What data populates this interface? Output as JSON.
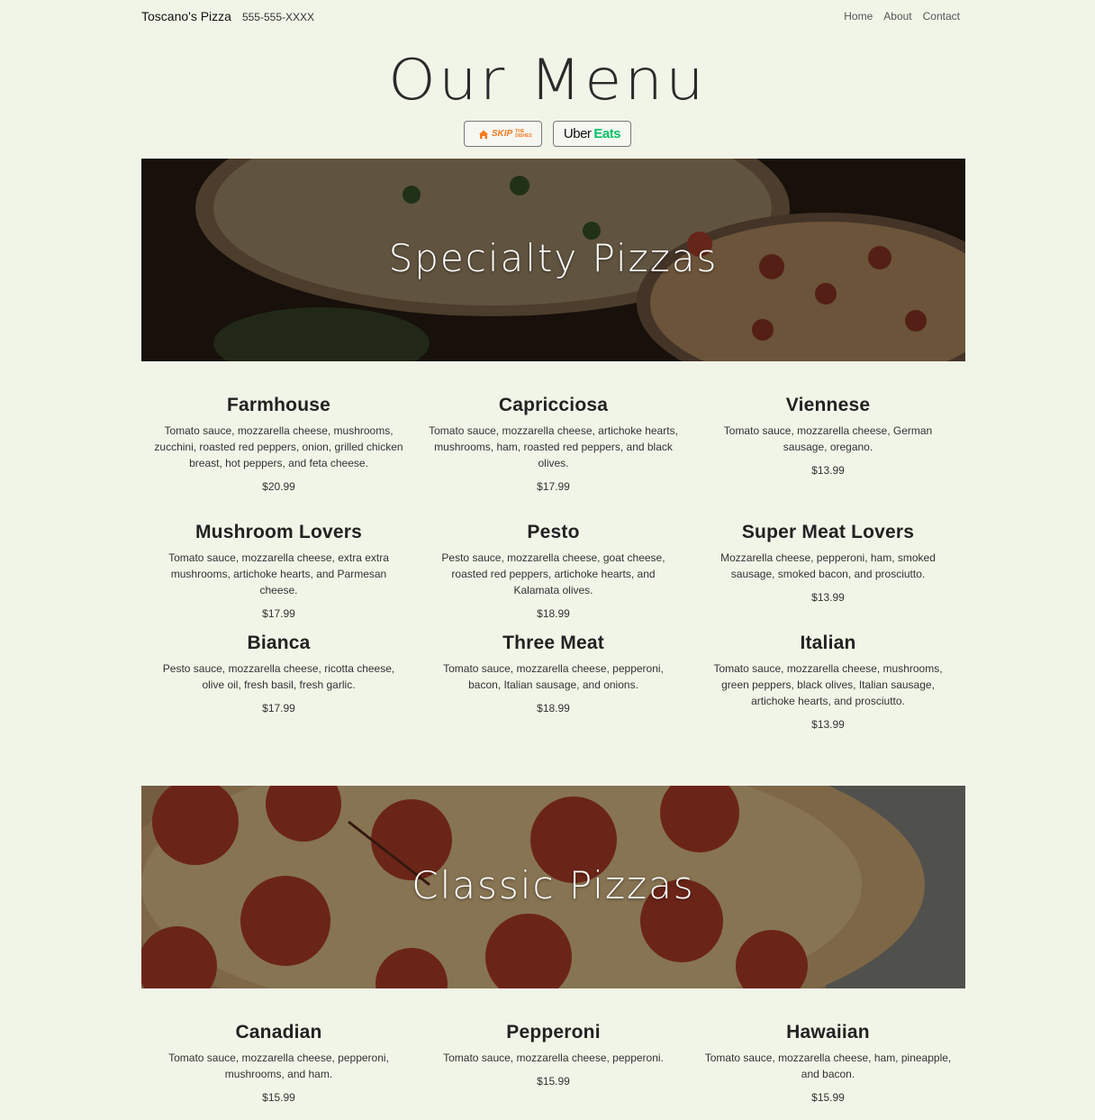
{
  "nav": {
    "brand": "Toscano's Pizza",
    "phone": "555-555-XXXX",
    "links": [
      "Home",
      "About",
      "Contact"
    ]
  },
  "title": "Our Menu",
  "delivery": {
    "skip": "SKIP",
    "skip_sub": "THE DISHES",
    "uber": "Uber",
    "eats": "Eats"
  },
  "sections": {
    "specialty": {
      "heading": "Specialty Pizzas",
      "items": [
        {
          "name": "Farmhouse",
          "desc": "Tomato sauce, mozzarella cheese, mushrooms, zucchini, roasted red peppers, onion, grilled chicken breast, hot peppers, and feta cheese.",
          "price": "$20.99"
        },
        {
          "name": "Capricciosa",
          "desc": "Tomato sauce, mozzarella cheese, artichoke hearts, mushrooms, ham, roasted red peppers, and black olives.",
          "price": "$17.99"
        },
        {
          "name": "Viennese",
          "desc": "Tomato sauce, mozzarella cheese, German sausage, oregano.",
          "price": "$13.99"
        },
        {
          "name": "Mushroom Lovers",
          "desc": "Tomato sauce, mozzarella cheese, extra extra mushrooms, artichoke hearts, and Parmesan cheese.",
          "price": "$17.99"
        },
        {
          "name": "Pesto",
          "desc": "Pesto sauce, mozzarella cheese, goat cheese, roasted red peppers, artichoke hearts, and Kalamata olives.",
          "price": "$18.99"
        },
        {
          "name": "Super Meat Lovers",
          "desc": "Mozzarella cheese, pepperoni, ham, smoked sausage, smoked bacon, and prosciutto.",
          "price": "$13.99"
        },
        {
          "name": "Bianca",
          "desc": "Pesto sauce, mozzarella cheese, ricotta cheese, olive oil, fresh basil, fresh garlic.",
          "price": "$17.99"
        },
        {
          "name": "Three Meat",
          "desc": "Tomato sauce, mozzarella cheese, pepperoni, bacon, Italian sausage, and onions.",
          "price": "$18.99"
        },
        {
          "name": "Italian",
          "desc": "Tomato sauce, mozzarella cheese, mushrooms, green peppers, black olives, Italian sausage, artichoke hearts, and prosciutto.",
          "price": "$13.99"
        }
      ]
    },
    "classic": {
      "heading": "Classic Pizzas",
      "items": [
        {
          "name": "Canadian",
          "desc": "Tomato sauce, mozzarella cheese, pepperoni, mushrooms, and ham.",
          "price": "$15.99"
        },
        {
          "name": "Pepperoni",
          "desc": "Tomato sauce, mozzarella cheese, pepperoni.",
          "price": "$15.99"
        },
        {
          "name": "Hawaiian",
          "desc": "Tomato sauce, mozzarella cheese, ham, pineapple, and bacon.",
          "price": "$15.99"
        }
      ]
    }
  },
  "colors": {
    "background": "#f1f5e8",
    "skip_orange": "#f47b20",
    "uber_green": "#06c167"
  }
}
